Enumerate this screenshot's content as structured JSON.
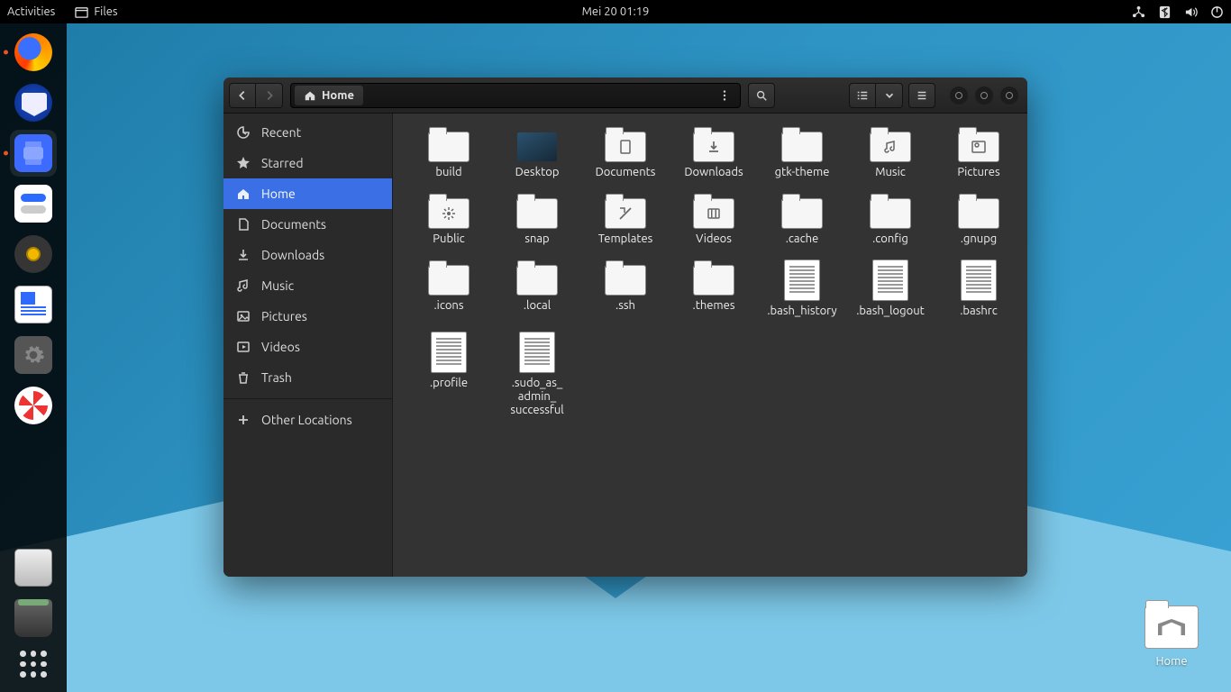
{
  "topbar": {
    "activities": "Activities",
    "app_name": "Files",
    "clock": "Mei 20  01:19"
  },
  "dock": {
    "items": [
      {
        "name": "firefox",
        "running": true
      },
      {
        "name": "thunderbird",
        "running": false
      },
      {
        "name": "files",
        "running": true,
        "active": true
      },
      {
        "name": "gnome-tweaks",
        "running": false
      },
      {
        "name": "rhythmbox",
        "running": false
      },
      {
        "name": "libreoffice-writer",
        "running": false
      },
      {
        "name": "settings",
        "running": false
      },
      {
        "name": "help",
        "running": false
      },
      {
        "name": "disks",
        "running": false
      },
      {
        "name": "trash",
        "running": false
      }
    ]
  },
  "desktop_icon": {
    "label": "Home"
  },
  "window": {
    "path": "Home",
    "sidebar": [
      {
        "icon": "recent",
        "label": "Recent"
      },
      {
        "icon": "star",
        "label": "Starred"
      },
      {
        "icon": "home",
        "label": "Home",
        "selected": true
      },
      {
        "icon": "documents",
        "label": "Documents"
      },
      {
        "icon": "downloads",
        "label": "Downloads"
      },
      {
        "icon": "music",
        "label": "Music"
      },
      {
        "icon": "pictures",
        "label": "Pictures"
      },
      {
        "icon": "videos",
        "label": "Videos"
      },
      {
        "icon": "trash",
        "label": "Trash"
      },
      {
        "sep": true
      },
      {
        "icon": "plus",
        "label": "Other Locations"
      }
    ],
    "files": [
      {
        "type": "folder",
        "label": "build"
      },
      {
        "type": "desktop",
        "label": "Desktop"
      },
      {
        "type": "folder",
        "icon": "documents",
        "label": "Documents"
      },
      {
        "type": "folder",
        "icon": "downloads",
        "label": "Downloads"
      },
      {
        "type": "folder",
        "label": "gtk-theme"
      },
      {
        "type": "folder",
        "icon": "music",
        "label": "Music"
      },
      {
        "type": "folder",
        "icon": "pictures",
        "label": "Pictures"
      },
      {
        "type": "folder",
        "icon": "public",
        "label": "Public"
      },
      {
        "type": "folder",
        "label": "snap"
      },
      {
        "type": "folder",
        "icon": "templates",
        "label": "Templates"
      },
      {
        "type": "folder",
        "icon": "videos",
        "label": "Videos"
      },
      {
        "type": "folder",
        "label": ".cache"
      },
      {
        "type": "folder",
        "label": ".config"
      },
      {
        "type": "folder",
        "label": ".gnupg"
      },
      {
        "type": "folder",
        "label": ".icons"
      },
      {
        "type": "folder",
        "label": ".local"
      },
      {
        "type": "folder",
        "label": ".ssh"
      },
      {
        "type": "folder",
        "label": ".themes"
      },
      {
        "type": "text",
        "label": ".bash_history"
      },
      {
        "type": "text",
        "label": ".bash_logout"
      },
      {
        "type": "text",
        "label": ".bashrc"
      },
      {
        "type": "text",
        "label": ".profile"
      },
      {
        "type": "text",
        "label": ".sudo_as_admin_successful"
      }
    ]
  }
}
